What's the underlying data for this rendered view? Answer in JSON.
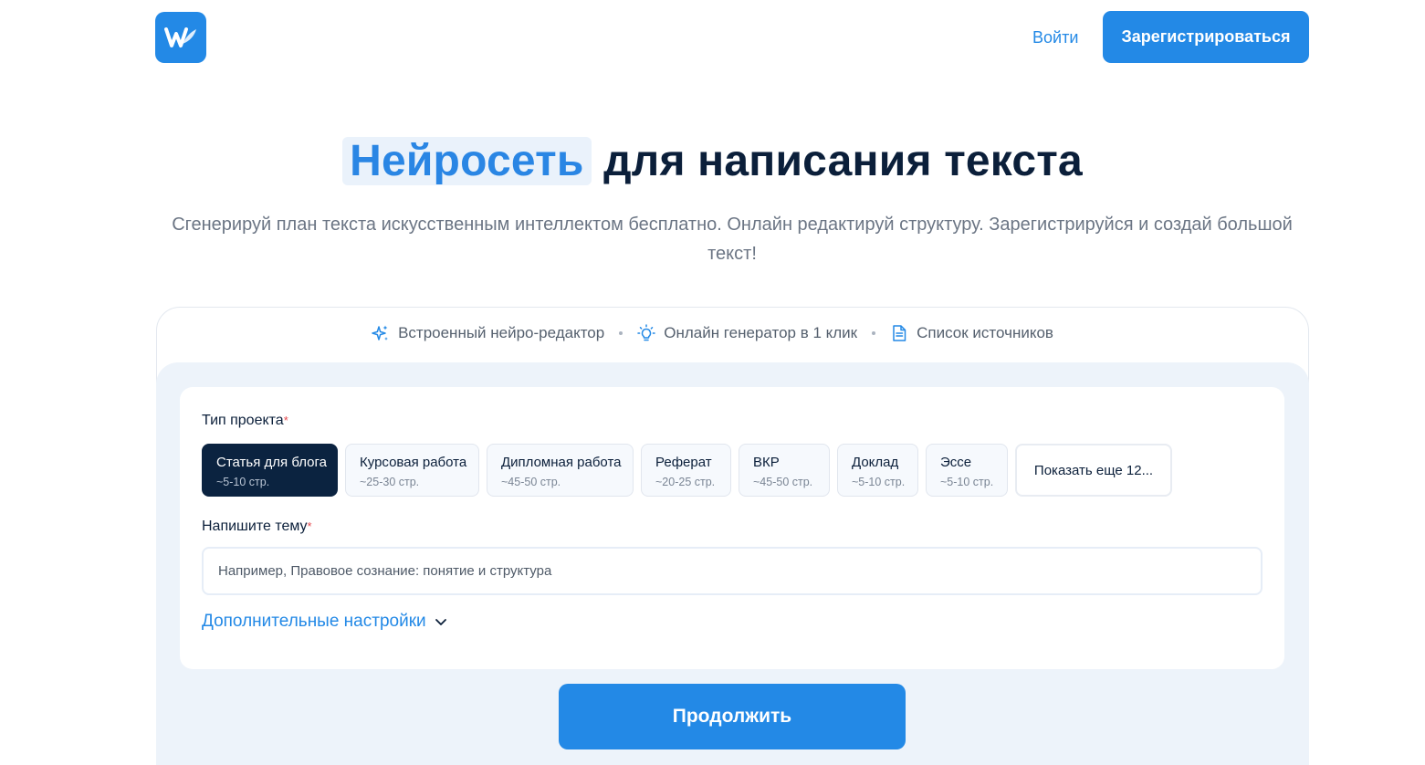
{
  "header": {
    "logo_icon": "w-quill-logo-icon",
    "login_label": "Войти",
    "signup_label": "Зарегистрироваться"
  },
  "hero": {
    "title_highlight": "Нейросеть",
    "title_rest": " для написания текста",
    "subtitle": "Сгенерируй план текста искусственным интеллектом бесплатно. Онлайн редактируй структуру. Зарегистрируйся и создай большой текст!"
  },
  "features": [
    {
      "icon": "sparkles-icon",
      "label": "Встроенный нейро-редактор"
    },
    {
      "icon": "lightbulb-icon",
      "label": "Онлайн генератор в 1 клик"
    },
    {
      "icon": "document-icon",
      "label": "Список источников"
    }
  ],
  "form": {
    "project_type_label": "Тип проекта",
    "required_mark": "*",
    "project_types": [
      {
        "title": "Статья для блога",
        "pages": "~5-10 стр.",
        "selected": true
      },
      {
        "title": "Курсовая работа",
        "pages": "~25-30 стр.",
        "selected": false
      },
      {
        "title": "Дипломная работа",
        "pages": "~45-50 стр.",
        "selected": false
      },
      {
        "title": "Реферат",
        "pages": "~20-25 стр.",
        "selected": false
      },
      {
        "title": "ВКР",
        "pages": "~45-50 стр.",
        "selected": false
      },
      {
        "title": "Доклад",
        "pages": "~5-10 стр.",
        "selected": false
      },
      {
        "title": "Эссе",
        "pages": "~5-10 стр.",
        "selected": false
      }
    ],
    "show_more_label": "Показать еще 12...",
    "topic_label": "Напишите тему",
    "topic_value": "",
    "topic_placeholder": "Например, Правовое сознание: понятие и структура",
    "advanced_label": "Дополнительные настройки",
    "continue_label": "Продолжить"
  },
  "colors": {
    "accent": "#2389e6",
    "dark_navy": "#0b2340",
    "panel_bg": "#edf3fa"
  }
}
